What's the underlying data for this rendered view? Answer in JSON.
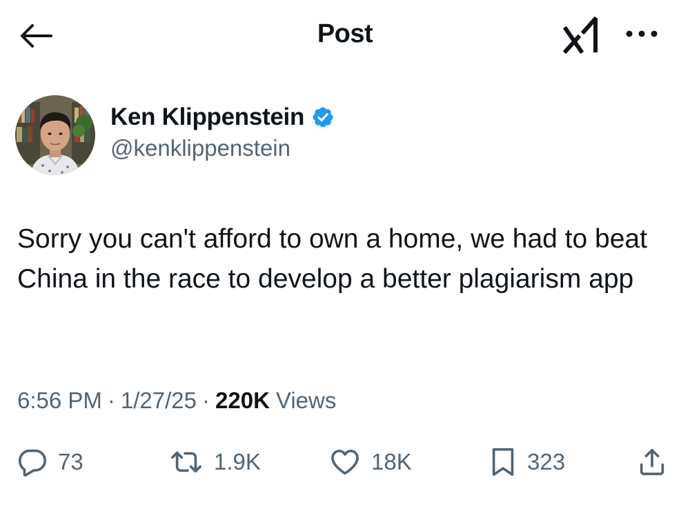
{
  "header": {
    "title": "Post",
    "back_icon": "arrow-left-icon",
    "grok_icon": "grok-logo-icon",
    "more_icon": "more-dots-icon"
  },
  "author": {
    "display_name": "Ken Klippenstein",
    "handle": "@kenklippenstein",
    "verified": true,
    "verified_color": "#1d9bf0"
  },
  "tweet": {
    "text": "Sorry you can't afford to own a home, we had to beat China in the race to develop a better plagiarism app"
  },
  "meta": {
    "time": "6:56 PM",
    "date": "1/27/25",
    "separator": "·",
    "views_count": "220K",
    "views_label": "Views"
  },
  "actions": {
    "replies": "73",
    "reposts": "1.9K",
    "likes": "18K",
    "bookmarks": "323"
  },
  "colors": {
    "text_primary": "#0f1419",
    "text_secondary": "#536471",
    "accent": "#1d9bf0"
  }
}
